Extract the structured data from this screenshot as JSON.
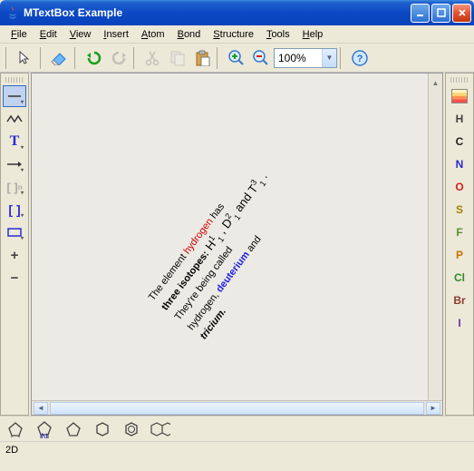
{
  "window": {
    "title": "MTextBox Example"
  },
  "menu": {
    "file": "File",
    "edit": "Edit",
    "view": "View",
    "insert": "Insert",
    "atom": "Atom",
    "bond": "Bond",
    "structure": "Structure",
    "tools": "Tools",
    "help": "Help"
  },
  "toolbar": {
    "zoom": "100%"
  },
  "left_tools": [
    {
      "name": "single-bond",
      "icon": "line",
      "sel": true,
      "dd": true
    },
    {
      "name": "zigzag-bond",
      "icon": "zigzag"
    },
    {
      "name": "text-tool",
      "icon": "T",
      "dd": true
    },
    {
      "name": "arrow-tool",
      "icon": "arrow",
      "dd": true
    },
    {
      "name": "bracket-gray",
      "icon": "bracket-g",
      "dd": true
    },
    {
      "name": "bracket-blue",
      "icon": "bracket-b",
      "dd": true
    },
    {
      "name": "rect-tool",
      "icon": "rect",
      "dd": true
    },
    {
      "name": "plus-tool",
      "icon": "plus"
    },
    {
      "name": "minus-tool",
      "icon": "minus"
    }
  ],
  "right_elements": [
    "H",
    "C",
    "N",
    "O",
    "S",
    "F",
    "P",
    "Cl",
    "Br",
    "I"
  ],
  "canvas_text": {
    "pre1": "The element ",
    "hydrogen": "hydrogen",
    "post1": " has ",
    "bold1": "three isotopes:",
    "iso": " H , D  and T  .",
    "line3a": "They're being called",
    "line4a": "hydrogen, ",
    "deut": "deuterium",
    "line4b": " and ",
    "bold2": "tricium."
  },
  "status": {
    "text": "2D"
  }
}
